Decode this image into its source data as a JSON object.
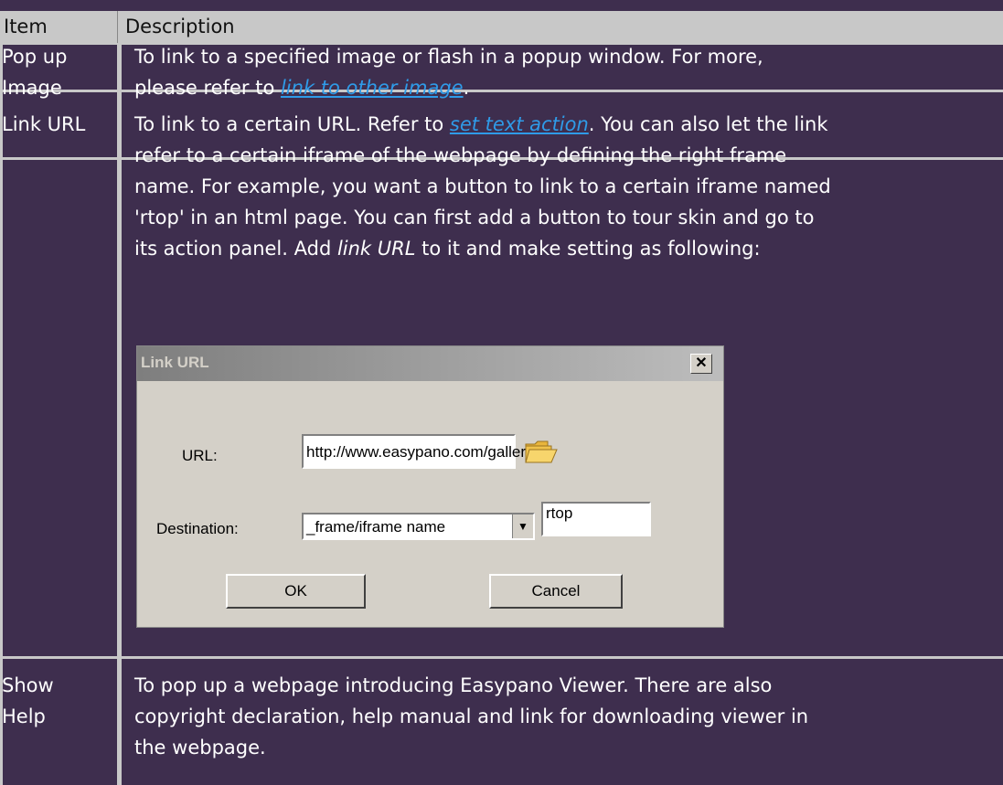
{
  "table": {
    "header": {
      "item": "Item",
      "description": "Description"
    },
    "rows": [
      {
        "item_line1": "Pop up",
        "item_line2": "Image",
        "desc_line1": "To link to a specified image or flash in a popup window. For more,",
        "desc_line2_pre": "please refer to ",
        "desc_line2_link": "link to other image",
        "desc_line2_post": "."
      },
      {
        "item": "Link URL",
        "desc_line1_pre": "To link to a certain URL. Refer to ",
        "desc_line1_link": "set text action",
        "desc_line1_post": ". You can also let the link",
        "desc_line2": "refer to a certain iframe of the webpage by defining the right frame",
        "desc_line3": "name. For example, you want a button to link to a certain iframe named",
        "desc_line4": "'rtop' in an html page. You can first add a button to tour skin and go to",
        "desc_line5_pre": "its action panel. Add ",
        "desc_line5_em": "link URL",
        "desc_line5_post": " to it and make setting as following:"
      },
      {
        "item_line1": "Show",
        "item_line2": "Help",
        "desc_line1": "To pop up a webpage introducing Easypano Viewer. There are also",
        "desc_line2": "copyright declaration, help manual and link for downloading viewer in",
        "desc_line3": "the webpage."
      }
    ]
  },
  "dialog": {
    "title": "Link URL",
    "close_glyph": "✕",
    "url_label": "URL:",
    "url_value": "http://www.easypano.com/galler",
    "folder_icon": "folder-open-icon",
    "destination_label": "Destination:",
    "destination_value": "_frame/iframe name",
    "frame_name_value": "rtop",
    "ok_label": "OK",
    "cancel_label": "Cancel"
  }
}
